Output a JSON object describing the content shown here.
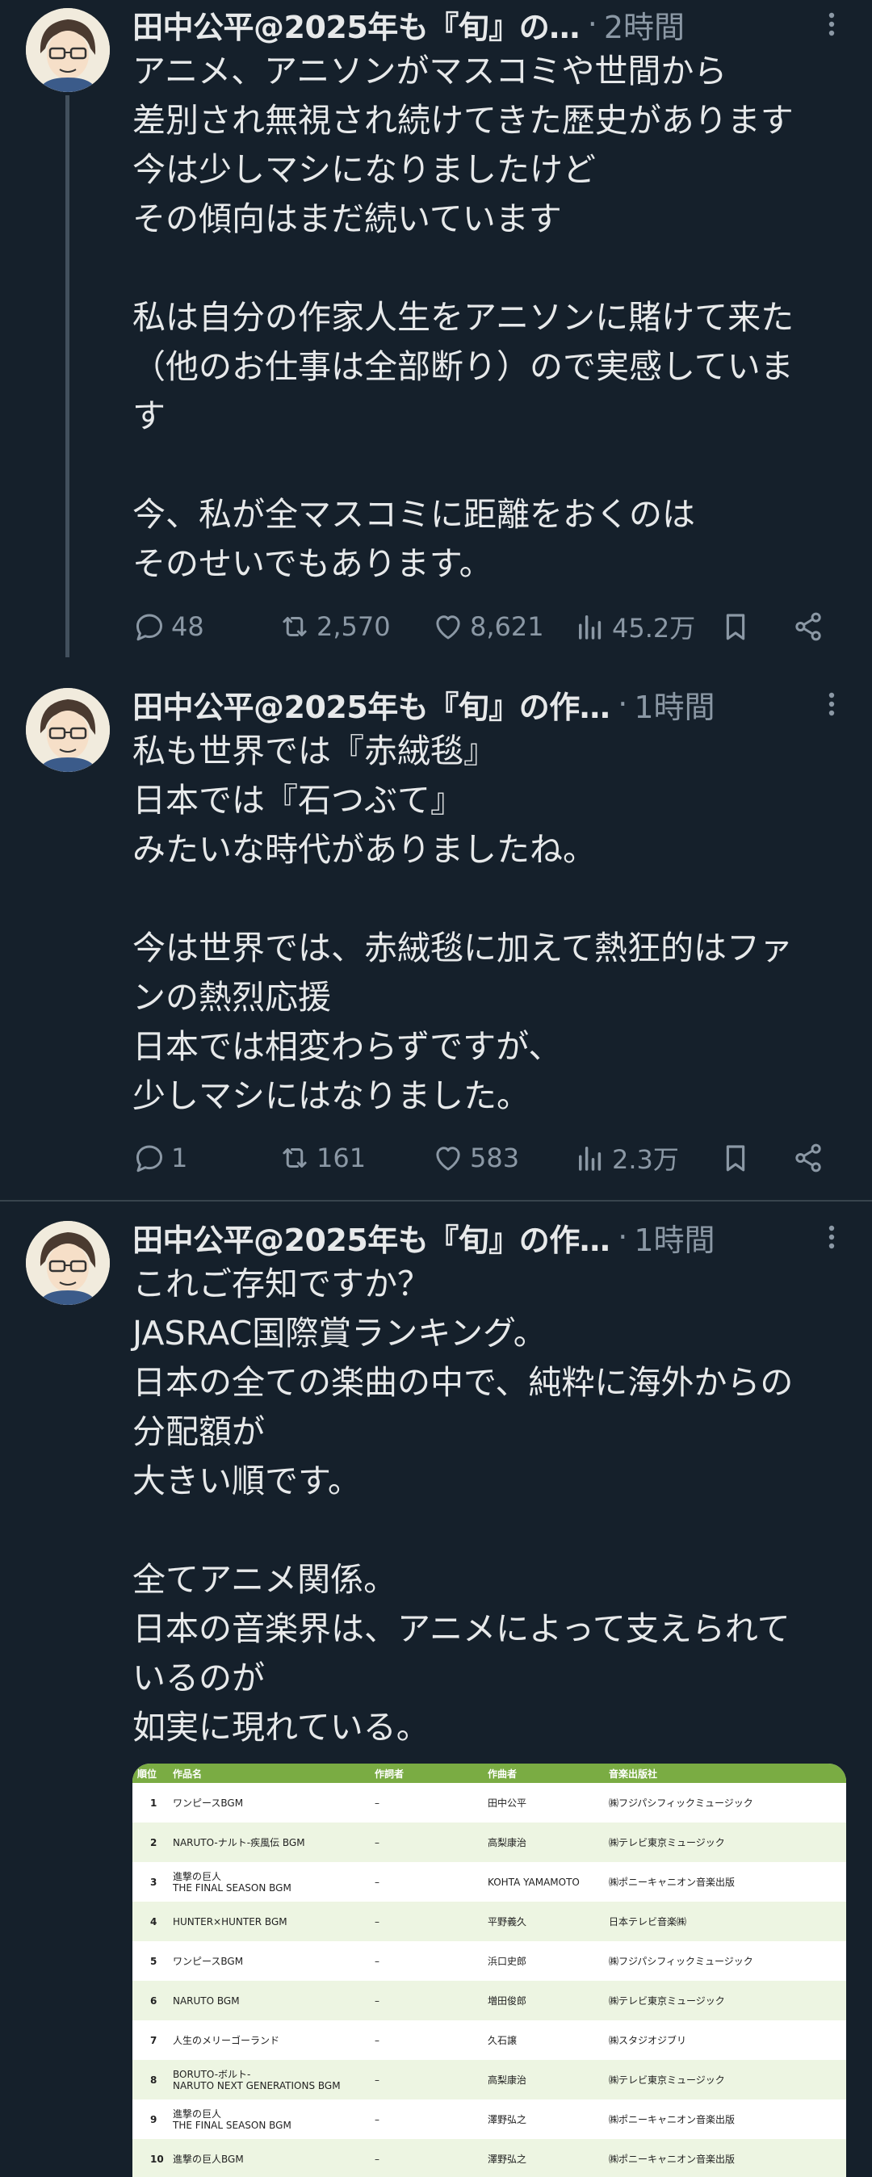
{
  "tweets": [
    {
      "author": "田中公平@2025年も『旬』の…",
      "time": "2時間",
      "text": "アニメ、アニソンがマスコミや世間から\n差別され無視され続けてきた歴史があります\n今は少しマシになりましたけど\nその傾向はまだ続いています\n\n私は自分の作家人生をアニソンに賭けて来た\n（他のお仕事は全部断り）ので実感していま\nす\n\n今、私が全マスコミに距離をおくのは\nそのせいでもあります。",
      "replies": "48",
      "reposts": "2,570",
      "likes": "8,621",
      "views": "45.2万"
    },
    {
      "author": "田中公平@2025年も『旬』の作…",
      "time": "1時間",
      "text": "私も世界では『赤絨毯』\n日本では『石つぶて』\nみたいな時代がありましたね。\n\n今は世界では、赤絨毯に加えて熱狂的はファ\nンの熱烈応援\n日本では相変わらずですが、\n少しマシにはなりました。",
      "replies": "1",
      "reposts": "161",
      "likes": "583",
      "views": "2.3万"
    },
    {
      "author": "田中公平@2025年も『旬』の作…",
      "time": "1時間",
      "text": "これご存知ですか？\nJASRAC国際賞ランキング。\n日本の全ての楽曲の中で、純粋に海外からの\n分配額が\n大きい順です。\n\n全てアニメ関係。\n日本の音楽界は、アニメによって支えられて\nいるのが\n如実に現れている。"
    }
  ],
  "ranking_table": {
    "headers": [
      "順位",
      "作品名",
      "作詞者",
      "作曲者",
      "音楽出版社"
    ],
    "rows": [
      {
        "rank": "1",
        "work": "ワンピースBGM",
        "lyricist": "–",
        "composer": "田中公平",
        "publisher": "㈱フジパシフィックミュージック"
      },
      {
        "rank": "2",
        "work": "NARUTO-ナルト-疾風伝 BGM",
        "lyricist": "–",
        "composer": "高梨康治",
        "publisher": "㈱テレビ東京ミュージック"
      },
      {
        "rank": "3",
        "work": "進撃の巨人\nTHE FINAL SEASON BGM",
        "lyricist": "–",
        "composer": "KOHTA YAMAMOTO",
        "publisher": "㈱ポニーキャニオン音楽出版"
      },
      {
        "rank": "4",
        "work": "HUNTER×HUNTER BGM",
        "lyricist": "–",
        "composer": "平野義久",
        "publisher": "日本テレビ音楽㈱"
      },
      {
        "rank": "5",
        "work": "ワンピースBGM",
        "lyricist": "–",
        "composer": "浜口史郎",
        "publisher": "㈱フジパシフィックミュージック"
      },
      {
        "rank": "6",
        "work": "NARUTO BGM",
        "lyricist": "–",
        "composer": "増田俊郎",
        "publisher": "㈱テレビ東京ミュージック"
      },
      {
        "rank": "7",
        "work": "人生のメリーゴーランド",
        "lyricist": "–",
        "composer": "久石譲",
        "publisher": "㈱スタジオジブリ"
      },
      {
        "rank": "8",
        "work": "BORUTO-ボルト-\nNARUTO NEXT GENERATIONS BGM",
        "lyricist": "–",
        "composer": "高梨康治",
        "publisher": "㈱テレビ東京ミュージック"
      },
      {
        "rank": "9",
        "work": "進撃の巨人\nTHE FINAL SEASON BGM",
        "lyricist": "–",
        "composer": "澤野弘之",
        "publisher": "㈱ポニーキャニオン音楽出版"
      },
      {
        "rank": "10",
        "work": "進撃の巨人BGM",
        "lyricist": "–",
        "composer": "澤野弘之",
        "publisher": "㈱ポニーキャニオン音楽出版"
      }
    ]
  },
  "colors": {
    "background": "#15202b",
    "text": "#e7e9ea",
    "secondary": "#8b98a5",
    "separator": "#38444d",
    "table_header": "#7aac43"
  },
  "icons": [
    "avatar",
    "more-icon",
    "reply-icon",
    "repost-icon",
    "like-icon",
    "views-icon",
    "bookmark-icon",
    "share-icon"
  ]
}
